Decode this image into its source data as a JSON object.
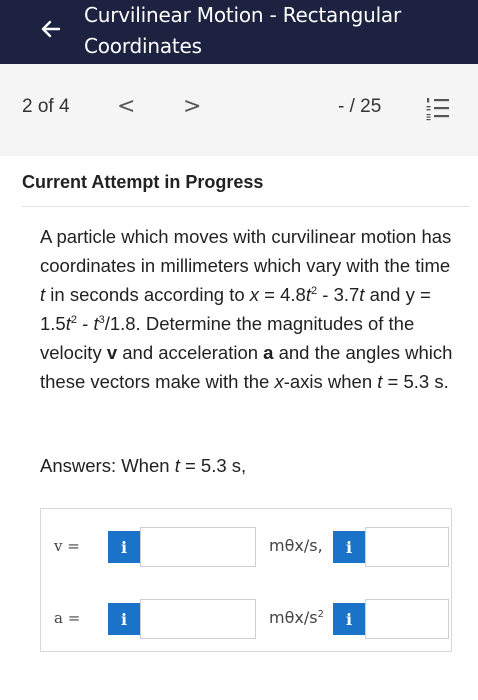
{
  "header": {
    "back_icon": "arrow-left-icon",
    "title_line1": "Curvilinear Motion - Rectangular",
    "title_line2": "Coordinates"
  },
  "nav": {
    "position": "2 of 4",
    "prev_icon": "chevron-left-icon",
    "next_icon": "chevron-right-icon",
    "prev": "<",
    "next": ">",
    "score": "- / 25",
    "list_icon": "numbered-list-icon"
  },
  "attempt": "Current Attempt in Progress",
  "question": {
    "part1": "A particle which moves with curvilinear motion has coordinates in millimeters which vary with the time ",
    "t1": "t",
    "part2": " in seconds according to ",
    "x1": "x",
    "part3": " = 4.8",
    "t2": "t",
    "sup1": "2",
    "part4": " - 3.7",
    "t3": "t",
    "part5": " and y = 1.5",
    "t4": "t",
    "sup2": "2",
    "part6": " - ",
    "t5": "t",
    "sup3": "3",
    "part7": "/1.8. Determine the magnitudes of the velocity ",
    "v": "v",
    "part8": " and acceleration ",
    "a": "a",
    "part9": " and the angles which these vectors make with the ",
    "x2": "x",
    "part10": "-axis when ",
    "t6": "t",
    "part11": " = 5.3 s."
  },
  "answers_intro": {
    "prefix": "Answers: When ",
    "t": "t",
    "suffix": " = 5.3 s,"
  },
  "rows": [
    {
      "label": "v =",
      "info": "i",
      "value": "",
      "unit": "mθx/s,",
      "unit_sup": "",
      "info2": "i",
      "value2": ""
    },
    {
      "label": "a =",
      "info": "i",
      "value": "",
      "unit": "mθx/s",
      "unit_sup": "2",
      "info2": "i",
      "value2": ""
    }
  ]
}
